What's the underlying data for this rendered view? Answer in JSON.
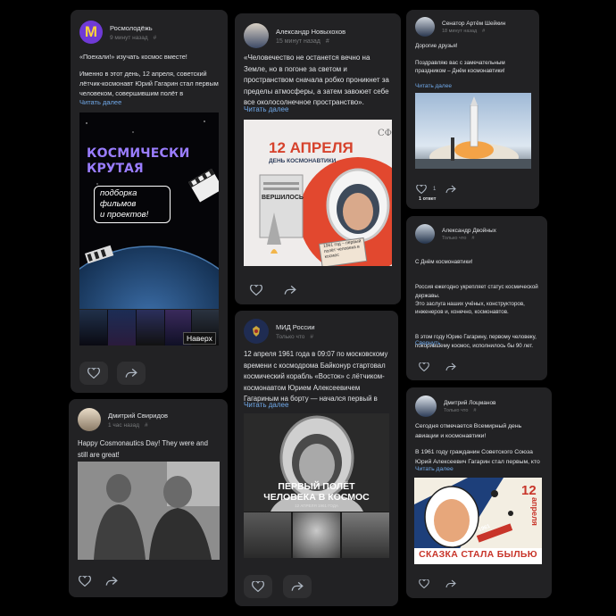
{
  "posts": [
    {
      "author": "Росмолодёжь",
      "time": "9 минут назад",
      "pin": "#",
      "avatar_letter": "M",
      "text": [
        "«Поехали!» изучать космос вместе!",
        "Именно в этот день, 12 апреля, советский лётчик-космонавт Юрий Гагарин стал первым человеком, совершившим полёт в"
      ],
      "more": "Читать далее",
      "poster": {
        "line1": "КОСМИЧЕСКИ",
        "line2": "КРУТАЯ",
        "box1": "подборка",
        "box2": "фильмов",
        "box3": "и проектов!"
      },
      "thumb_tag": "Наверх"
    },
    {
      "author": "Александр Новыхохов",
      "time": "15 минут назад",
      "pin": "#",
      "text": [
        "«Человечество не останется вечно на Земле, но в погоне за светом и пространством сначала робко проникнет за пределы атмосферы, а затем завоюет себе все околосолнечное пространство»."
      ],
      "more": "Читать далее",
      "poster": {
        "date": "12 АПРЕЛЯ",
        "sub": "ДЕНЬ КОСМОНАВТИКИ",
        "clip": "1961 год – первый полёт человека в космос",
        "paper": "ВЕРШИЛОСЬ"
      }
    },
    {
      "author": "Сенатор Артём Шейкин",
      "time": "18 минут назад",
      "pin": "#",
      "text": [
        "Дорогие друзья!",
        "Поздравляю вас с замечательным праздником – Днём космонавтики!"
      ],
      "more": "Читать далее",
      "likes": "1",
      "reply": "1 ответ"
    },
    {
      "author": "Александр Двойных",
      "time": "Только что",
      "pin": "#",
      "text": [
        "С Днём космонавтики!",
        "Россия ежегодно укрепляет статус космической державы.\nЭто заслуга наших учёных, конструкторов, инженеров и, конечно, космонавтов.",
        "В этом году Юрию Гагарину, первому человеку, покорившему космос, исполнилось бы 90 лет."
      ],
      "more": "Свернуть"
    },
    {
      "author": "Дмитрий Свиридов",
      "time": "1 час назад",
      "pin": "#",
      "text": [
        "Happy Cosmonautics Day! They were and still are great!"
      ]
    },
    {
      "author": "МИД России",
      "time": "Только что",
      "pin": "#",
      "text": [
        "12 апреля 1961 года в 09:07 по московскому времени с космодрома Байконур стартовал космический корабль «Восток» с лётчиком-космонавтом Юрием Алексеевичем Гагариным на борту — начался первый в"
      ],
      "more": "Читать далее",
      "poster": {
        "title1": "ПЕРВЫЙ ПОЛЁТ",
        "title2": "ЧЕЛОВЕКА В КОСМОС",
        "sub": "12 АПРЕЛЯ 1961 ГОДА"
      }
    },
    {
      "author": "Дмитрий Лоцманов",
      "time": "Только что",
      "pin": "#",
      "text": [
        "Сегодня отмечается Всемирный день авиации и космонавтики!",
        "В 1961 году гражданин Советского Союза Юрий Алексеевич Гагарин стал первым, кто"
      ],
      "more": "Читать далее",
      "poster": {
        "day": "12",
        "month": "апреля",
        "year": "1961",
        "slogan": "СКАЗКА СТАЛА БЫЛЬЮ"
      }
    }
  ],
  "colors": {
    "bg": "#000000",
    "card": "#222224",
    "link": "#71aaeb",
    "muted": "#76787a",
    "violet": "#7b5cff"
  }
}
